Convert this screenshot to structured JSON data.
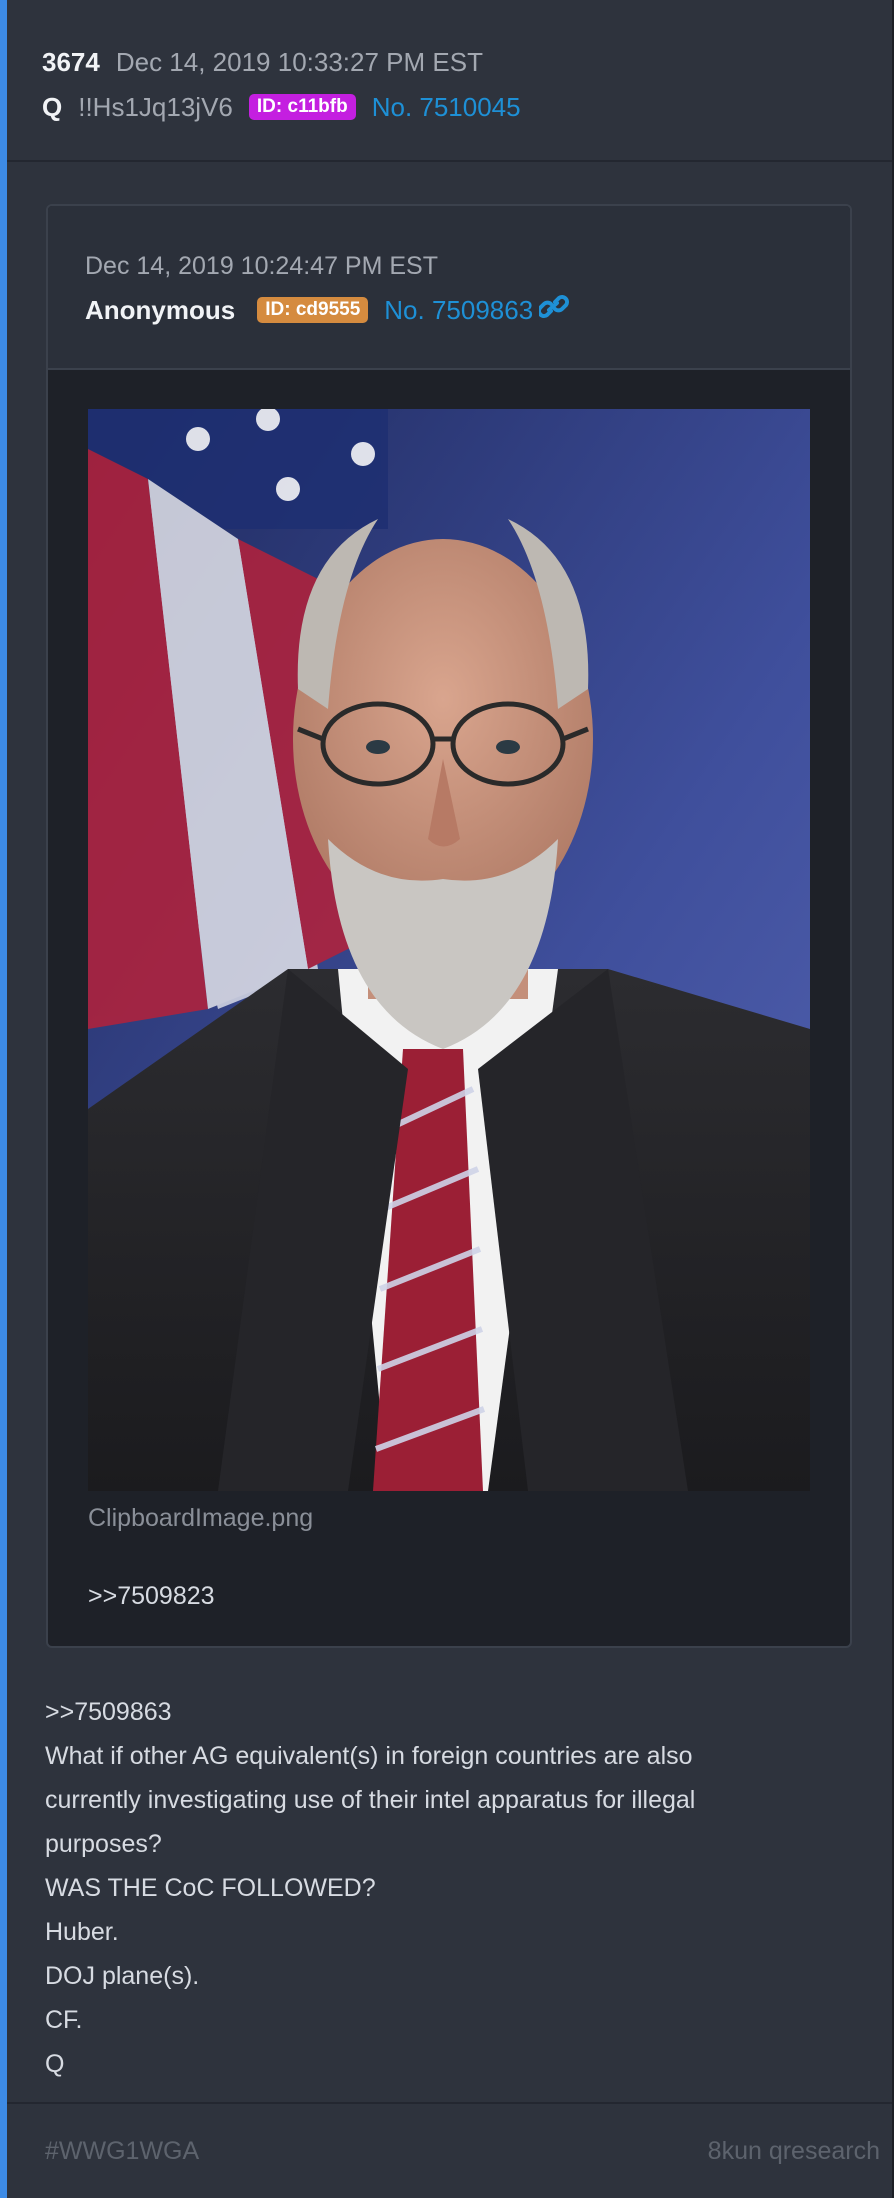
{
  "post": {
    "number": "3674",
    "date": "Dec 14, 2019 10:33:27 PM EST",
    "author": "Q",
    "tripcode": "!!Hs1Jq13jV6",
    "id_badge": "ID: c11bfb",
    "post_link": "No. 7510045"
  },
  "quoted": {
    "date": "Dec 14, 2019 10:24:47 PM EST",
    "author": "Anonymous",
    "id_badge": "ID: cd9555",
    "post_link": "No. 7509863",
    "link_icon": "link-icon",
    "image_filename": "ClipboardImage.png",
    "reply_ref": ">>7509823"
  },
  "body": {
    "lines": [
      ">>7509863",
      "What if other AG equivalent(s) in foreign countries are also",
      "currently investigating use of their intel apparatus for illegal",
      "purposes?",
      "WAS THE CoC FOLLOWED?",
      "Huber.",
      "DOJ plane(s).",
      "CF.",
      "Q"
    ]
  },
  "footer": {
    "hashtag": "#WWG1WGA",
    "source": "8kun qresearch"
  },
  "colors": {
    "accent_bar": "#3d8be6",
    "link": "#1e90d6",
    "badge_purple": "#c41fe0",
    "badge_orange": "#d58b3f"
  }
}
